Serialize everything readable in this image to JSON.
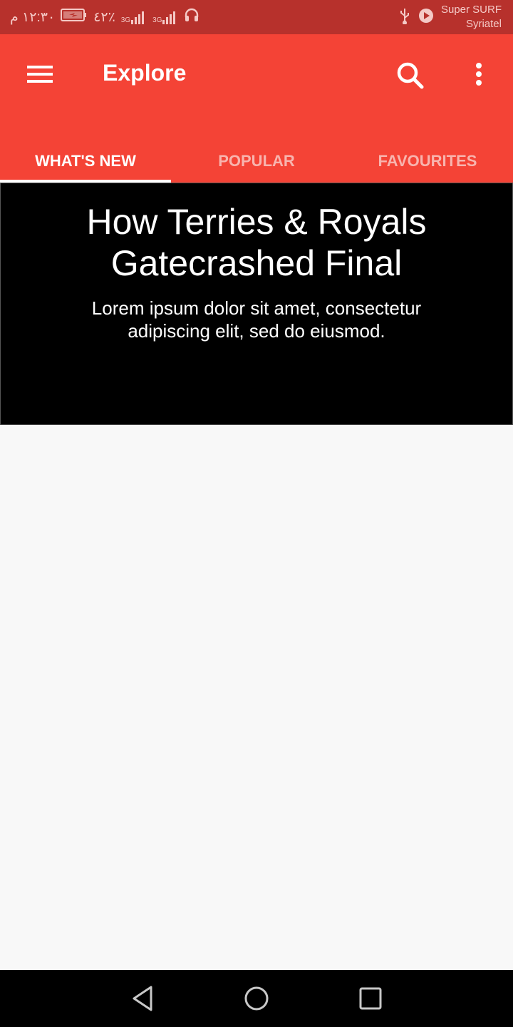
{
  "status_bar": {
    "time": "١٢:٣٠ م",
    "battery": "٤٢٪",
    "network_1": "3G",
    "network_2": "3G",
    "carrier_line1": "Super SURF",
    "carrier_line2": "Syriatel",
    "icons": [
      "battery-charging-icon",
      "signal-icon",
      "headset-icon",
      "usb-icon",
      "play-icon"
    ]
  },
  "app_bar": {
    "title": "Explore",
    "background": "#f44336",
    "icons": [
      "menu-icon",
      "search-icon",
      "more-vert-icon"
    ]
  },
  "tabs": [
    {
      "label": "WHAT'S NEW",
      "active": true
    },
    {
      "label": "POPULAR",
      "active": false
    },
    {
      "label": "FAVOURITES",
      "active": false
    }
  ],
  "hero": {
    "title": "How Terries & Royals Gatecrashed Final",
    "subtitle": "Lorem ipsum dolor sit amet, consectetur adipiscing elit, sed do eiusmod."
  },
  "nav_bar": {
    "icons": [
      "back-icon",
      "home-icon",
      "recents-icon"
    ]
  }
}
